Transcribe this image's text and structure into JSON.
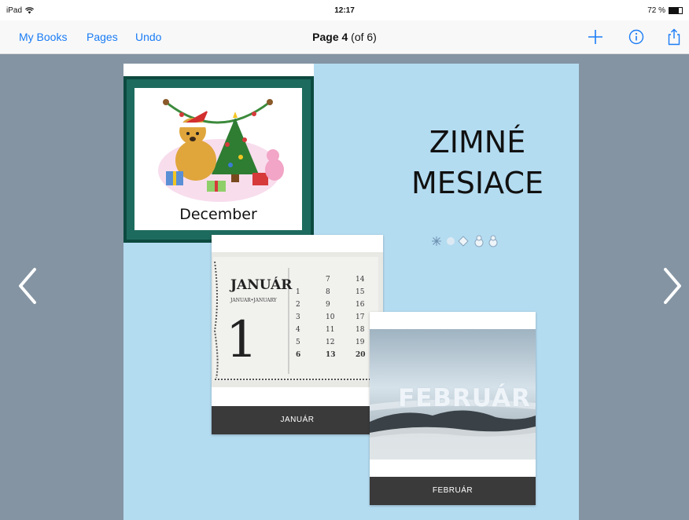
{
  "status_bar": {
    "device": "iPad",
    "time": "12:17",
    "battery": "72 %",
    "battery_level": 0.72
  },
  "nav": {
    "my_books": "My Books",
    "pages": "Pages",
    "undo": "Undo",
    "title_page": "Page 4",
    "title_of": " (of 6)",
    "add_icon": "plus-icon",
    "info_icon": "info-icon",
    "share_icon": "share-icon"
  },
  "colors": {
    "accent": "#1a7cf5",
    "stage_bg": "#8494a3",
    "page_bg": "#b4dcf1",
    "frame_green": "#1d6b5e",
    "label_bg": "#3a3a3a"
  },
  "page": {
    "title_line1": "ZIMNÉ",
    "title_line2": "MESIACE",
    "december_caption": "December",
    "january_label": "JANUÁR",
    "february_label": "FEBRUÁR",
    "calendar": {
      "month": "JANUÁR",
      "subtitle": "JANUAR•JANUARY",
      "big_number": "1",
      "days": [
        "1",
        "2",
        "3",
        "4",
        "5",
        "6",
        "7",
        "8",
        "9",
        "10",
        "11",
        "12",
        "13",
        "14",
        "15",
        "16",
        "17",
        "18",
        "19",
        "20"
      ]
    },
    "february_photo_text": "FEBRUÁR"
  }
}
